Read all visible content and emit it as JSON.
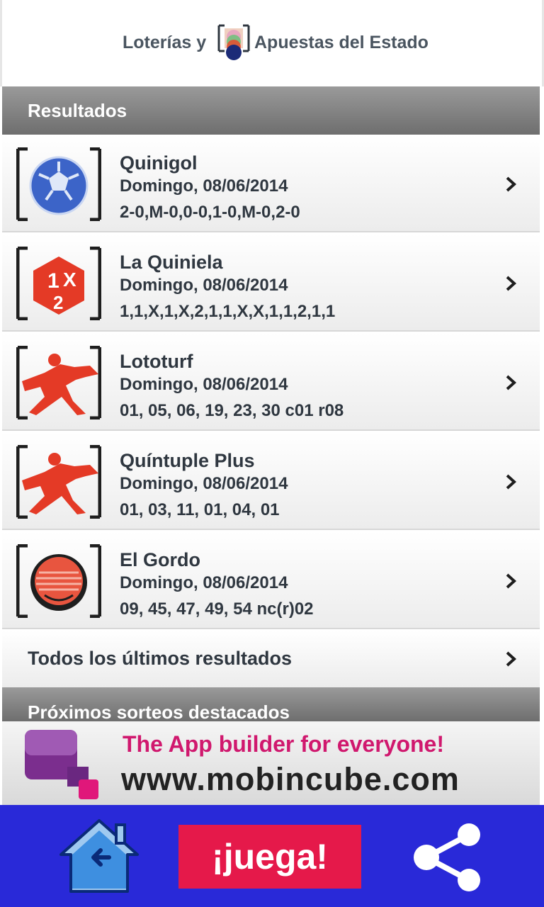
{
  "header": {
    "brand_left": "Loterías y",
    "brand_right": "Apuestas del Estado"
  },
  "results_section": {
    "title": "Resultados"
  },
  "games": [
    {
      "name": "Quinigol",
      "date": "Domingo, 08/06/2014",
      "result": "2-0,M-0,0-0,1-0,M-0,2-0",
      "icon": "soccer-ball-icon"
    },
    {
      "name": "La Quiniela",
      "date": "Domingo, 08/06/2014",
      "result": "1,1,X,1,X,2,1,1,X,X,1,1,2,1,1",
      "icon": "quiniela-1x2-icon"
    },
    {
      "name": "Lototurf",
      "date": "Domingo, 08/06/2014",
      "result": "01, 05, 06, 19, 23, 30 c01 r08",
      "icon": "horse-rider-icon"
    },
    {
      "name": "Quíntuple Plus",
      "date": "Domingo, 08/06/2014",
      "result": "01, 03, 11, 01, 04, 01",
      "icon": "horse-rider-icon"
    },
    {
      "name": "El Gordo",
      "date": "Domingo, 08/06/2014",
      "result": "09, 45, 47, 49, 54 nc(r)02",
      "icon": "el-gordo-icon"
    }
  ],
  "all_results": {
    "label": "Todos los últimos resultados"
  },
  "upcoming_section": {
    "title": "Próximos sorteos destacados"
  },
  "ad": {
    "line1": "The App builder for everyone!",
    "line2": "www.mobincube.com"
  },
  "bottom_bar": {
    "play_label": "¡juega!",
    "home_icon": "home-icon",
    "share_icon": "share-icon"
  },
  "colors": {
    "bottom_bar": "#2929d8",
    "play_button": "#e5194a",
    "section_bar": "#7a7a7a",
    "ad_accent": "#d0186e"
  }
}
